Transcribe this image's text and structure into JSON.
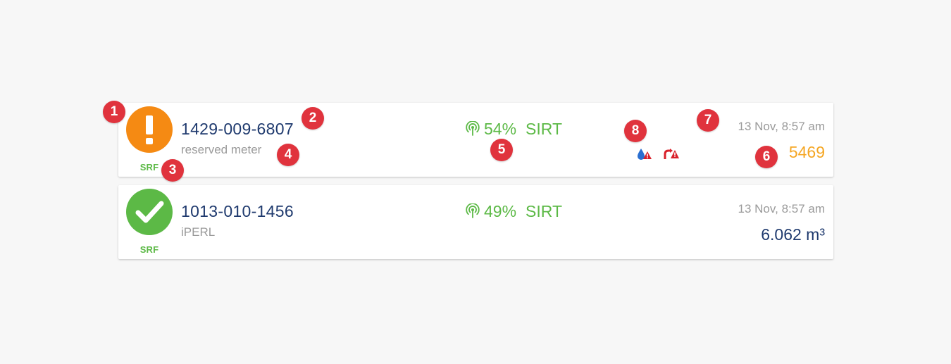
{
  "colors": {
    "warning_orange": "#f5a623",
    "status_orange": "#f58a13",
    "ok_green": "#5cb946",
    "id_navy": "#1f3a6e",
    "muted_gray": "#9a9a9a",
    "marker_red": "#e0333d"
  },
  "meters": [
    {
      "status_icon": "exclamation-icon",
      "status": "warning",
      "protocol": "SRF",
      "meter_id": "1429-009-6807",
      "meter_type": "reserved meter",
      "signal_icon": "signal-antenna-icon",
      "signal_strength": "54%",
      "signal_type": "SIRT",
      "alarms": [
        {
          "icon": "water-leak-alarm-icon"
        },
        {
          "icon": "backflow-alarm-icon"
        }
      ],
      "timestamp": "13 Nov, 8:57 am",
      "reading": "5469"
    },
    {
      "status_icon": "checkmark-icon",
      "status": "ok",
      "protocol": "SRF",
      "meter_id": "1013-010-1456",
      "meter_type": "iPERL",
      "signal_icon": "signal-antenna-icon",
      "signal_strength": "49%",
      "signal_type": "SIRT",
      "alarms": [],
      "timestamp": "13 Nov, 8:57 am",
      "reading": "6.062 m³"
    }
  ],
  "markers": [
    "1",
    "2",
    "3",
    "4",
    "5",
    "6",
    "7",
    "8"
  ]
}
